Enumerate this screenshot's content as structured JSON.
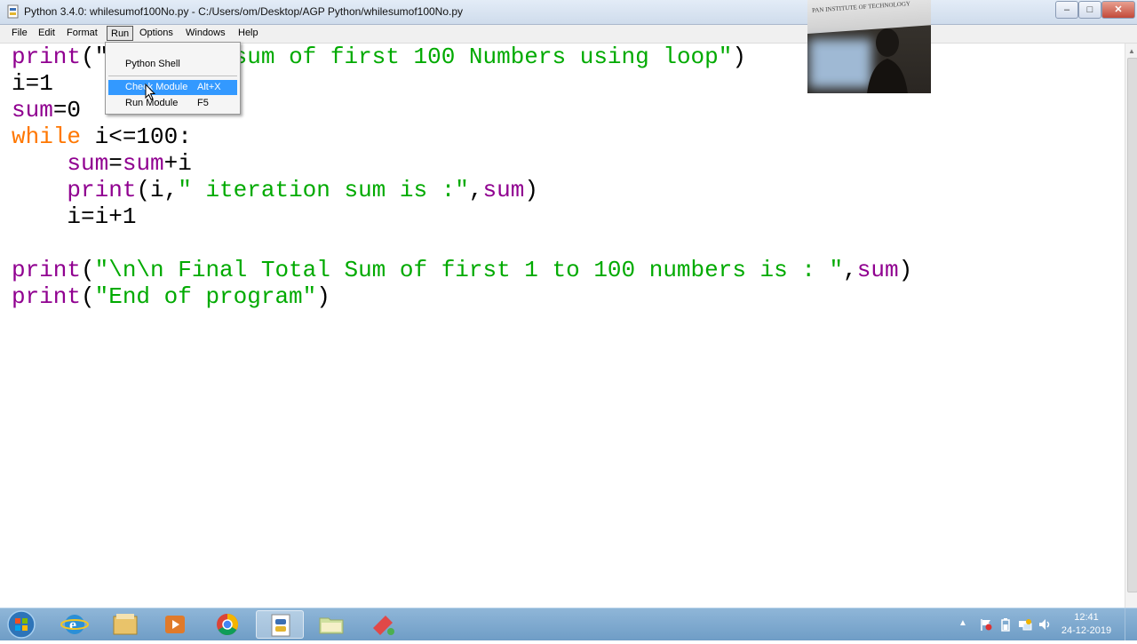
{
  "window": {
    "title": "Python 3.4.0: whilesumof100No.py - C:/Users/om/Desktop/AGP Python/whilesumof100No.py",
    "icon": "python-file-icon"
  },
  "menubar": {
    "items": [
      "File",
      "Edit",
      "Format",
      "Run",
      "Options",
      "Windows",
      "Help"
    ],
    "open_menu": "Run"
  },
  "run_menu": {
    "items": [
      {
        "label": "Python Shell",
        "accelerator": ""
      },
      {
        "label": "Check Module",
        "accelerator": "Alt+X",
        "highlighted": true
      },
      {
        "label": "Run Module",
        "accelerator": "F5"
      }
    ]
  },
  "editor": {
    "filename": "whilesumof100No.py",
    "syntax_colors": {
      "keyword": "#ff7700",
      "builtin": "#900090",
      "string": "#00aa00",
      "default": "#000000"
    },
    "lines": [
      [
        {
          "t": "print",
          "c": "bi"
        },
        {
          "t": "(\"",
          "c": ""
        },
        {
          "t": "         sum of first 100 Numbers using loop\"",
          "c": "st"
        },
        {
          "t": ")",
          "c": ""
        }
      ],
      [
        {
          "t": "i=1",
          "c": ""
        }
      ],
      [
        {
          "t": "sum",
          "c": "bi"
        },
        {
          "t": "=0",
          "c": ""
        }
      ],
      [
        {
          "t": "while",
          "c": "kw"
        },
        {
          "t": " i<=100:",
          "c": ""
        }
      ],
      [
        {
          "t": "    ",
          "c": ""
        },
        {
          "t": "sum",
          "c": "bi"
        },
        {
          "t": "=",
          "c": ""
        },
        {
          "t": "sum",
          "c": "bi"
        },
        {
          "t": "+i",
          "c": ""
        }
      ],
      [
        {
          "t": "    ",
          "c": ""
        },
        {
          "t": "print",
          "c": "bi"
        },
        {
          "t": "(i,",
          "c": ""
        },
        {
          "t": "\" iteration sum is :\"",
          "c": "st"
        },
        {
          "t": ",",
          "c": ""
        },
        {
          "t": "sum",
          "c": "bi"
        },
        {
          "t": ")",
          "c": ""
        }
      ],
      [
        {
          "t": "    i=i+1",
          "c": ""
        }
      ],
      [
        {
          "t": "",
          "c": ""
        }
      ],
      [
        {
          "t": "print",
          "c": "bi"
        },
        {
          "t": "(",
          "c": ""
        },
        {
          "t": "\"\\n\\n Final Total Sum of first 1 to 100 numbers is : \"",
          "c": "st"
        },
        {
          "t": ",",
          "c": ""
        },
        {
          "t": "sum",
          "c": "bi"
        },
        {
          "t": ")",
          "c": ""
        }
      ],
      [
        {
          "t": "print",
          "c": "bi"
        },
        {
          "t": "(",
          "c": ""
        },
        {
          "t": "\"End of program\"",
          "c": "st"
        },
        {
          "t": ")",
          "c": ""
        }
      ]
    ]
  },
  "webcam": {
    "sign_text": "PAN INSTITUTE OF TECHNOLOGY"
  },
  "taskbar": {
    "apps": [
      "start-orb-icon",
      "internet-explorer-icon",
      "file-explorer-icon",
      "media-player-icon",
      "chrome-icon",
      "python-idle-icon",
      "folder-icon",
      "paint-icon"
    ],
    "active_app": "python-idle-icon",
    "clock_time": "12:41",
    "clock_date": "24-12-2019"
  }
}
